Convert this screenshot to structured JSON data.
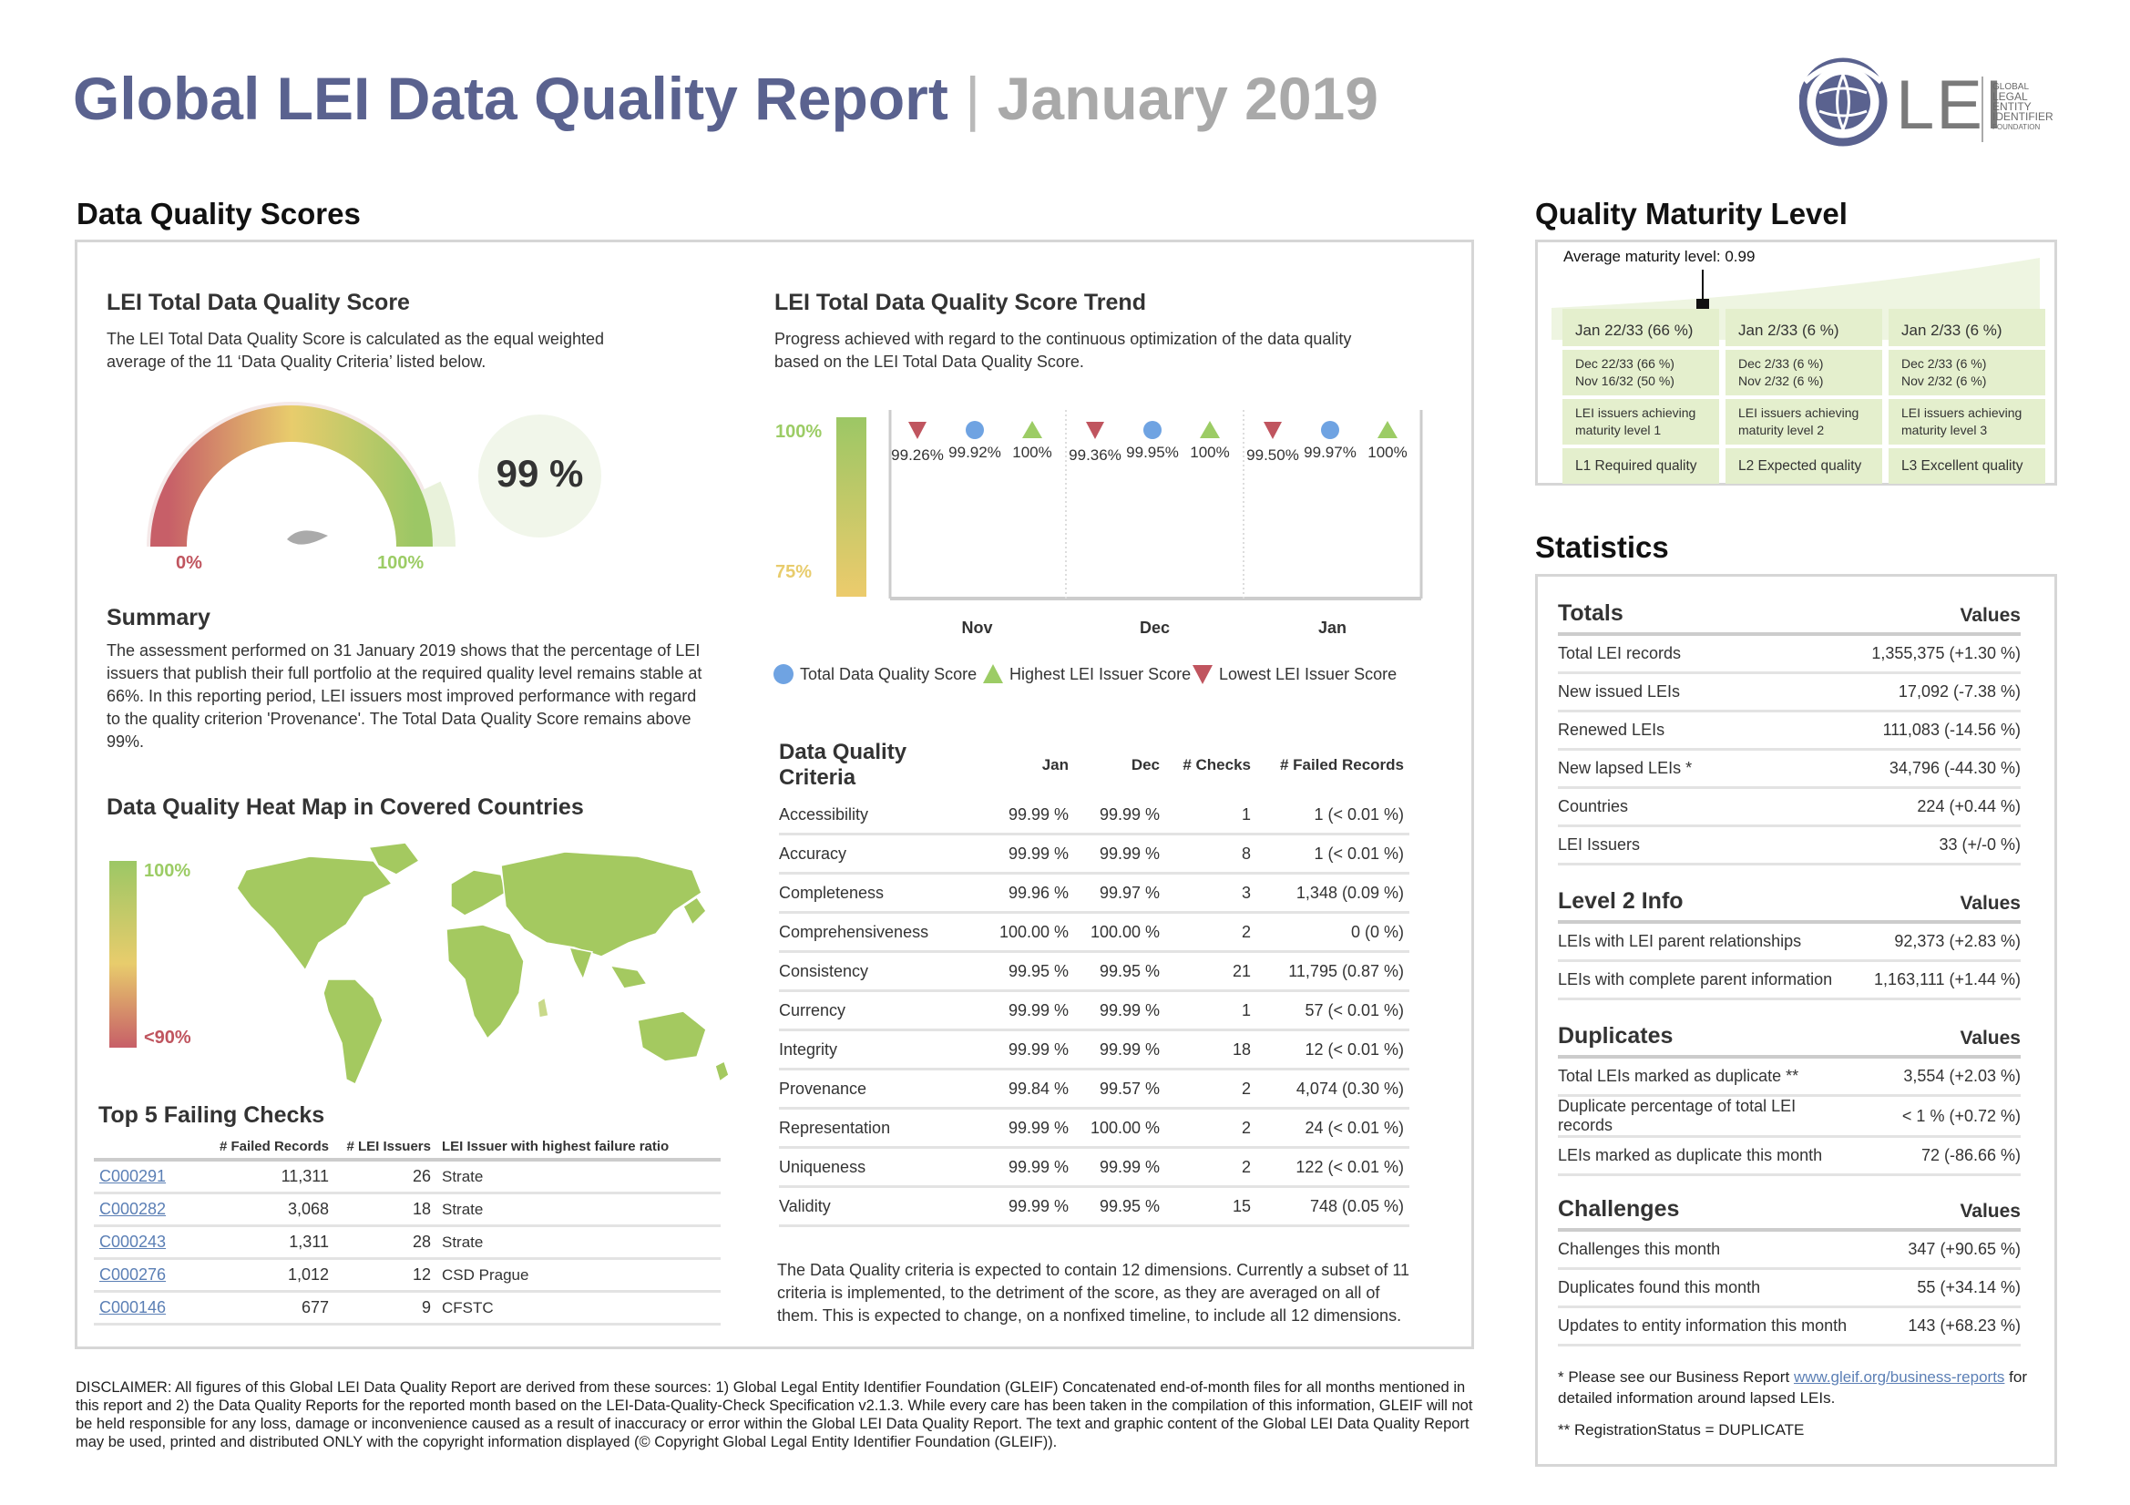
{
  "header": {
    "title": "Global LEI Data Quality Report",
    "separator": "|",
    "period": "January 2019",
    "logo_text": "LEI",
    "logo_subtext": [
      "GLOBAL",
      "LEGAL",
      "ENTITY",
      "IDENTIFIER",
      "FOUNDATION"
    ]
  },
  "scores": {
    "heading": "Data Quality Scores",
    "total": {
      "heading": "LEI Total Data Quality Score",
      "description": "The LEI Total Data Quality Score is calculated as the equal weighted average of the 11 ‘Data Quality Criteria’ listed below.",
      "gauge_min": "0%",
      "gauge_max": "100%",
      "score": "99 %",
      "score_value": 99
    },
    "summary": {
      "heading": "Summary",
      "text": "The assessment performed on 31 January 2019 shows that the percentage of LEI issuers that publish their full portfolio at the required quality level remains stable at 66%. In this reporting period, LEI issuers most improved performance with regard to the quality criterion 'Provenance'. The Total Data Quality Score remains above 99%."
    },
    "heatmap": {
      "heading": "Data Quality Heat Map in Covered Countries",
      "scale_top": "100%",
      "scale_bottom": "<90%"
    },
    "trend": {
      "heading": "LEI Total Data Quality Score Trend",
      "description": "Progress achieved with regard to the continuous optimization of the data quality based on the LEI Total Data Quality Score.",
      "scale_top": "100%",
      "scale_bottom": "75%",
      "legend": [
        "Total Data Quality Score",
        "Highest LEI Issuer Score",
        "Lowest LEI Issuer Score"
      ],
      "colors": {
        "total": "#6fa3e2",
        "highest": "#9ccc65",
        "lowest": "#c0555f"
      }
    }
  },
  "chart_data": {
    "type": "scatter",
    "categories": [
      "Nov",
      "Dec",
      "Jan"
    ],
    "series": [
      {
        "name": "Lowest LEI Issuer Score",
        "values": [
          99.26,
          99.36,
          99.5
        ],
        "labels": [
          "99.26%",
          "99.36%",
          "99.50%"
        ]
      },
      {
        "name": "Total Data Quality Score",
        "values": [
          99.92,
          99.95,
          99.97
        ],
        "labels": [
          "99.92%",
          "99.95%",
          "99.97%"
        ]
      },
      {
        "name": "Highest LEI Issuer Score",
        "values": [
          100,
          100,
          100
        ],
        "labels": [
          "100%",
          "100%",
          "100%"
        ]
      }
    ]
  },
  "criteria": {
    "heading": "Data Quality Criteria",
    "columns": [
      "Jan",
      "Dec",
      "# Checks",
      "# Failed Records"
    ],
    "rows": [
      [
        "Accessibility",
        "99.99 %",
        "99.99 %",
        "1",
        "1 (< 0.01 %)"
      ],
      [
        "Accuracy",
        "99.99 %",
        "99.99 %",
        "8",
        "1 (< 0.01 %)"
      ],
      [
        "Completeness",
        "99.96 %",
        "99.97 %",
        "3",
        "1,348 (0.09 %)"
      ],
      [
        "Comprehensiveness",
        "100.00 %",
        "100.00 %",
        "2",
        "0 (0 %)"
      ],
      [
        "Consistency",
        "99.95 %",
        "99.95 %",
        "21",
        "11,795 (0.87 %)"
      ],
      [
        "Currency",
        "99.99 %",
        "99.99 %",
        "1",
        "57 (< 0.01 %)"
      ],
      [
        "Integrity",
        "99.99 %",
        "99.99 %",
        "18",
        "12 (< 0.01 %)"
      ],
      [
        "Provenance",
        "99.84 %",
        "99.57 %",
        "2",
        "4,074 (0.30 %)"
      ],
      [
        "Representation",
        "99.99 %",
        "100.00 %",
        "2",
        "24 (< 0.01 %)"
      ],
      [
        "Uniqueness",
        "99.99 %",
        "99.99 %",
        "2",
        "122 (< 0.01 %)"
      ],
      [
        "Validity",
        "99.99 %",
        "99.95 %",
        "15",
        "748 (0.05 %)"
      ]
    ],
    "note": "The Data Quality criteria is expected to contain 12 dimensions. Currently a subset of 11 criteria is implemented, to the detriment of the score, as they are averaged on all of them. This is expected to change, on a nonfixed timeline, to include all 12 dimensions."
  },
  "failing": {
    "heading": "Top 5 Failing Checks",
    "columns": [
      "# Failed Records",
      "# LEI Issuers",
      "LEI Issuer with highest failure ratio"
    ],
    "rows": [
      [
        "C000291",
        "11,311",
        "26",
        "Strate"
      ],
      [
        "C000282",
        "3,068",
        "18",
        "Strate"
      ],
      [
        "C000243",
        "1,311",
        "28",
        "Strate"
      ],
      [
        "C000276",
        "1,012",
        "12",
        "CSD Prague"
      ],
      [
        "C000146",
        "677",
        "9",
        "CFSTC"
      ]
    ]
  },
  "maturity": {
    "heading": "Quality Maturity Level",
    "average": "Average maturity level: 0.99",
    "average_value": 0.99,
    "levels": [
      {
        "head": "Jan 22/33 (66 %)",
        "history": [
          "Dec 22/33 (66 %)",
          "Nov 16/32 (50 %)"
        ],
        "desc": "LEI issuers achieving maturity level 1",
        "label": "L1 Required quality"
      },
      {
        "head": "Jan 2/33 (6 %)",
        "history": [
          "Dec 2/33 (6 %)",
          "Nov 2/32 (6 %)"
        ],
        "desc": "LEI issuers achieving maturity level 2",
        "label": "L2 Expected quality"
      },
      {
        "head": "Jan 2/33 (6 %)",
        "history": [
          "Dec 2/33 (6 %)",
          "Nov 2/32 (6 %)"
        ],
        "desc": "LEI issuers achieving maturity level 3",
        "label": "L3 Excellent quality"
      }
    ]
  },
  "statistics": {
    "heading": "Statistics",
    "values_label": "Values",
    "groups": [
      {
        "title": "Totals",
        "rows": [
          [
            "Total LEI records",
            "1,355,375 (+1.30 %)"
          ],
          [
            "New issued LEIs",
            "17,092 (-7.38 %)"
          ],
          [
            "Renewed LEIs",
            "111,083 (-14.56 %)"
          ],
          [
            "New lapsed LEIs *",
            "34,796 (-44.30 %)"
          ],
          [
            "Countries",
            "224 (+0.44 %)"
          ],
          [
            "LEI Issuers",
            "33 (+/-0 %)"
          ]
        ]
      },
      {
        "title": "Level 2 Info",
        "rows": [
          [
            "LEIs with LEI parent relationships",
            "92,373 (+2.83 %)"
          ],
          [
            "LEIs with complete parent information",
            "1,163,111 (+1.44 %)"
          ]
        ]
      },
      {
        "title": "Duplicates",
        "rows": [
          [
            "Total LEIs marked as duplicate **",
            "3,554 (+2.03 %)"
          ],
          [
            "Duplicate percentage of total LEI records",
            "< 1 % (+0.72 %)"
          ],
          [
            "LEIs marked as duplicate this month",
            "72 (-86.66 %)"
          ]
        ]
      },
      {
        "title": "Challenges",
        "rows": [
          [
            "Challenges this month",
            "347 (+90.65 %)"
          ],
          [
            "Duplicates found this month",
            "55 (+34.14 %)"
          ],
          [
            "Updates to entity information this month",
            "143 (+68.23 %)"
          ]
        ]
      }
    ],
    "footnote1_pre": "* Please see our Business Report",
    "footnote1_link": "www.gleif.org/business-reports",
    "footnote1_post": "for detailed information around lapsed LEIs.",
    "footnote2": "** RegistrationStatus = DUPLICATE"
  },
  "disclaimer": "DISCLAIMER: All figures of this Global LEI Data Quality Report are derived from these sources: 1) Global Legal Entity Identifier Foundation (GLEIF) Concatenated end-of-month files for all months mentioned in this report and 2) the Data Quality Reports for the reported month based on the LEI-Data-Quality-Check Specification v2.1.3. While every care has been taken in the compilation of this information, GLEIF will not be held responsible for any loss, damage or inconvenience caused as a result of inaccuracy or error within the Global LEI Data Quality Report. The text and graphic content of the Global LEI Data Quality Report may be used, printed and distributed ONLY with the copyright information displayed (© Copyright Global Legal Entity Identifier Foundation (GLEIF))."
}
